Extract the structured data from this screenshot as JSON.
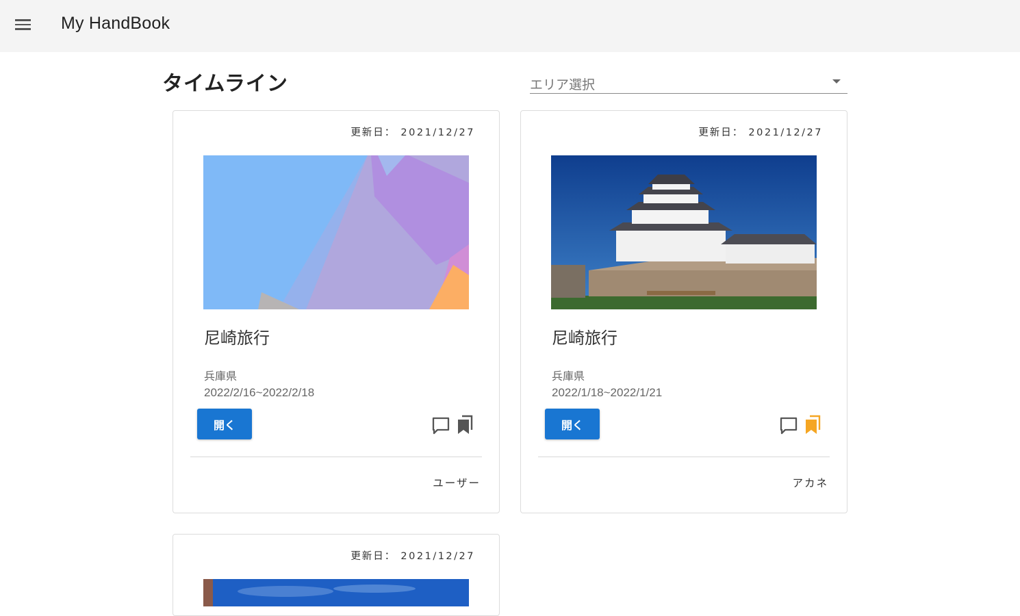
{
  "header": {
    "app_title": "My HandBook",
    "menu_icon": "menu-icon"
  },
  "main": {
    "page_title": "タイムライン",
    "area_select": {
      "placeholder": "エリア選択"
    }
  },
  "cards": [
    {
      "updated_label": "更新日：",
      "updated_date": "2021/12/27",
      "title": "尼崎旅行",
      "prefecture": "兵庫県",
      "dates": "2022/2/16~2022/2/18",
      "open_label": "開く",
      "author": "ユーザー",
      "bookmarked": false,
      "image": "abstract-paper"
    },
    {
      "updated_label": "更新日：",
      "updated_date": "2021/12/27",
      "title": "尼崎旅行",
      "prefecture": "兵庫県",
      "dates": "2022/1/18~2022/1/21",
      "open_label": "開く",
      "author": "アカネ",
      "bookmarked": true,
      "image": "castle"
    },
    {
      "updated_label": "更新日：",
      "updated_date": "2021/12/27",
      "image": "sky"
    }
  ],
  "colors": {
    "primary": "#1976d2",
    "bookmark_active": "#f5a623",
    "bookmark_inactive": "#555555",
    "appbar_bg": "#f4f4f4"
  }
}
